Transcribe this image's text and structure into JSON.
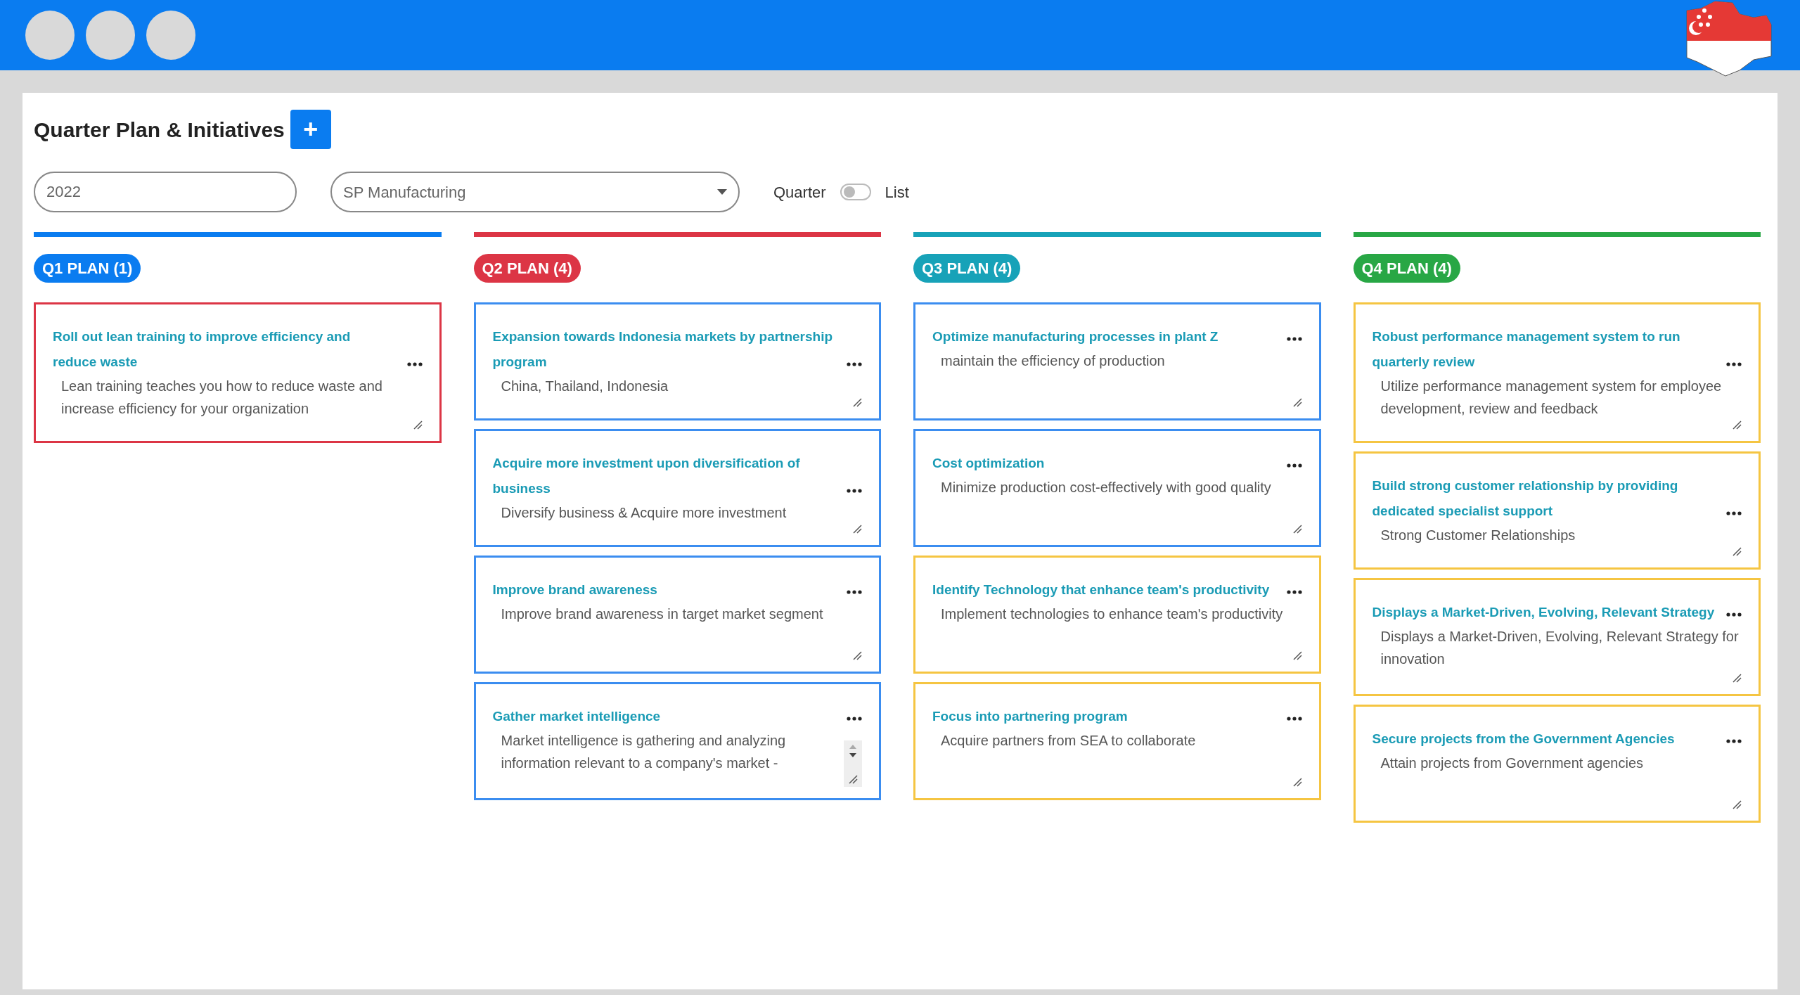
{
  "page": {
    "title": "Quarter Plan & Initiatives",
    "add_button": "+"
  },
  "filters": {
    "year": "2022",
    "company": "SP Manufacturing",
    "toggle": {
      "left_label": "Quarter",
      "right_label": "List",
      "on": false
    }
  },
  "columns": [
    {
      "label": "Q1 PLAN (1)",
      "color": "#0a7cf0",
      "cards": [
        {
          "title": "Roll out lean training to improve efficiency and reduce waste",
          "description": "Lean training teaches you how to reduce waste and increase efficiency for your organization",
          "color": "#dc3545",
          "scrollable": false
        }
      ]
    },
    {
      "label": "Q2 PLAN (4)",
      "color": "#dc3545",
      "cards": [
        {
          "title": "Expansion towards Indonesia markets by partnership program",
          "description": "China, Thailand, Indonesia",
          "color": "#3b8df0",
          "scrollable": false
        },
        {
          "title": "Acquire more investment upon diversification of business",
          "description": "Diversify business & Acquire more investment",
          "color": "#3b8df0",
          "scrollable": false
        },
        {
          "title": "Improve brand awareness",
          "description": "Improve brand awareness in target market segment",
          "color": "#3b8df0",
          "scrollable": false
        },
        {
          "title": "Gather market intelligence",
          "description": "Market intelligence is gathering and analyzing information relevant to a company's market -",
          "color": "#3b8df0",
          "scrollable": true
        }
      ]
    },
    {
      "label": "Q3 PLAN (4)",
      "color": "#17a2b8",
      "cards": [
        {
          "title": "Optimize manufacturing processes in plant Z",
          "description": "maintain the efficiency of production",
          "color": "#3b8df0",
          "scrollable": false
        },
        {
          "title": "Cost optimization",
          "description": "Minimize production cost-effectively with good quality",
          "color": "#3b8df0",
          "scrollable": false
        },
        {
          "title": "Identify Technology that enhance team's productivity",
          "description": "Implement technologies to enhance team's productivity",
          "color": "#f5c542",
          "scrollable": false
        },
        {
          "title": "Focus into partnering program",
          "description": "Acquire partners from SEA to collaborate",
          "color": "#f5c542",
          "scrollable": false
        }
      ]
    },
    {
      "label": "Q4 PLAN (4)",
      "color": "#28a745",
      "cards": [
        {
          "title": "Robust performance management system to run quarterly review",
          "description": "Utilize performance management system for employee development, review and feedback",
          "color": "#f5c542",
          "scrollable": false
        },
        {
          "title": "Build strong customer relationship by providing dedicated specialist support",
          "description": "Strong Customer Relationships",
          "color": "#f5c542",
          "scrollable": false
        },
        {
          "title": "Displays a Market-Driven, Evolving, Relevant Strategy",
          "description": "Displays a Market-Driven, Evolving, Relevant Strategy for innovation",
          "color": "#f5c542",
          "scrollable": false
        },
        {
          "title": "Secure projects from the Government Agencies",
          "description": "Attain projects from Government agencies",
          "color": "#f5c542",
          "scrollable": false
        }
      ]
    }
  ]
}
